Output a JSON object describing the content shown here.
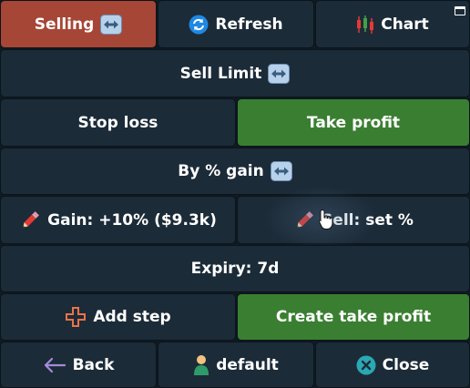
{
  "row1": {
    "selling": "Selling",
    "refresh": "Refresh",
    "chart": "Chart"
  },
  "sell_limit": "Sell Limit",
  "row3": {
    "stop_loss": "Stop loss",
    "take_profit": "Take profit"
  },
  "by_gain": "By % gain",
  "row5": {
    "gain": "Gain: +10% ($9.3k)",
    "sell": "Sell: set %"
  },
  "expiry": "Expiry: 7d",
  "row7": {
    "add_step": "Add step",
    "create_take_profit": "Create take profit"
  },
  "row8": {
    "back": "Back",
    "default": "default",
    "close": "Close"
  },
  "colors": {
    "background": "#0f1a22",
    "button": "#1c2b38",
    "active_red": "#a64636",
    "active_green": "#3a7f31"
  },
  "icons": {
    "arrows": "left-right-arrows-icon",
    "refresh": "refresh-icon",
    "chart": "candlestick-chart-icon",
    "pencil": "pencil-icon",
    "add": "plus-icon",
    "back": "left-arrow-icon",
    "user": "user-icon",
    "close": "close-circle-icon"
  }
}
